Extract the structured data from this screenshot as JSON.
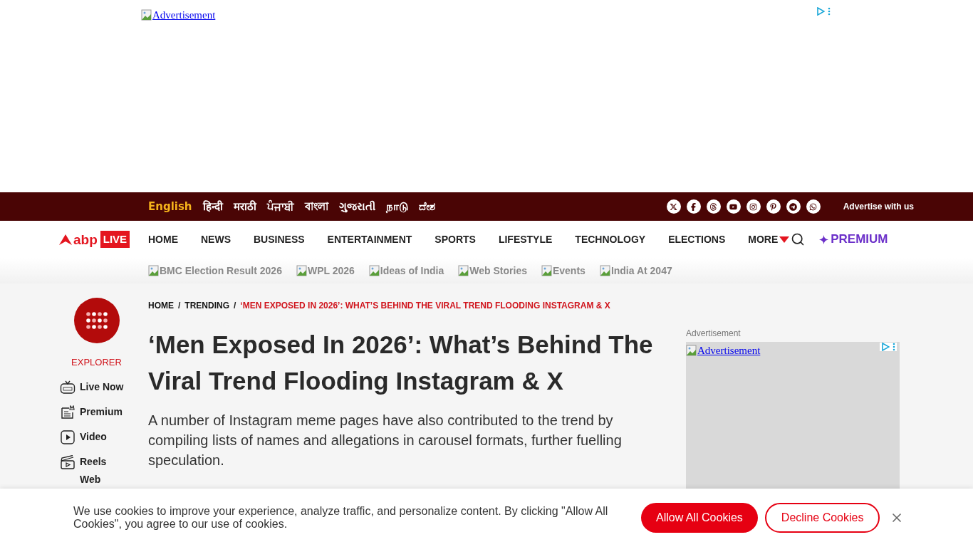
{
  "top_ad": {
    "label": "Advertisement"
  },
  "language_bar": {
    "languages": [
      {
        "label": "English",
        "selected": true
      },
      {
        "label": "हिन्दी",
        "selected": false
      },
      {
        "label": "मराठी",
        "selected": false
      },
      {
        "label": "ਪੰਜਾਬੀ",
        "selected": false
      },
      {
        "label": "বাংলা",
        "selected": false
      },
      {
        "label": "ગુજરાતી",
        "selected": false
      },
      {
        "label": "நாடு",
        "selected": false
      },
      {
        "label": "ದೇಶ",
        "selected": false
      }
    ],
    "advertise_link": "Advertise with us"
  },
  "nav": {
    "logo": {
      "brand": "abp",
      "badge": "LIVE"
    },
    "items": [
      "HOME",
      "NEWS",
      "BUSINESS",
      "ENTERTAINMENT",
      "SPORTS",
      "LIFESTYLE",
      "TECHNOLOGY",
      "ELECTIONS"
    ],
    "more": "MORE",
    "premium": "PREMIUM"
  },
  "trending_links": [
    "BMC Election Result 2026",
    "WPL 2026",
    "Ideas of India",
    "Web Stories",
    "Events",
    "India At 2047"
  ],
  "sidebar": {
    "explorer_label": "EXPLORER",
    "items": [
      {
        "label": "Live Now",
        "kind": "live"
      },
      {
        "label": "Premium",
        "kind": "premium"
      },
      {
        "label": "Video",
        "kind": "video"
      },
      {
        "label": "Reels",
        "kind": "reels"
      },
      {
        "label": "Web",
        "kind": "web"
      }
    ]
  },
  "breadcrumb_separator": "/",
  "breadcrumb": [
    {
      "label": "HOME",
      "current": false
    },
    {
      "label": "TRENDING",
      "current": false
    },
    {
      "label": "‘MEN EXPOSED IN 2026’: WHAT’S BEHIND THE VIRAL TREND FLOODING INSTAGRAM & X",
      "current": true
    }
  ],
  "article": {
    "title": "‘Men Exposed In 2026’: What’s Behind The Viral Trend Flooding Instagram & X",
    "summary": "A number of Instagram meme pages have also contributed to the trend by compiling lists of names and allegations in carousel formats, further fuelling speculation."
  },
  "side_ad": {
    "caption": "Advertisement",
    "label": "Advertisement"
  },
  "cookie_banner": {
    "text": "We use cookies to improve your experience, analyze traffic, and personalize content. By clicking \"Allow All Cookies\", you agree to our use of cookies.",
    "accept": "Allow All Cookies",
    "decline": "Decline Cookies"
  }
}
